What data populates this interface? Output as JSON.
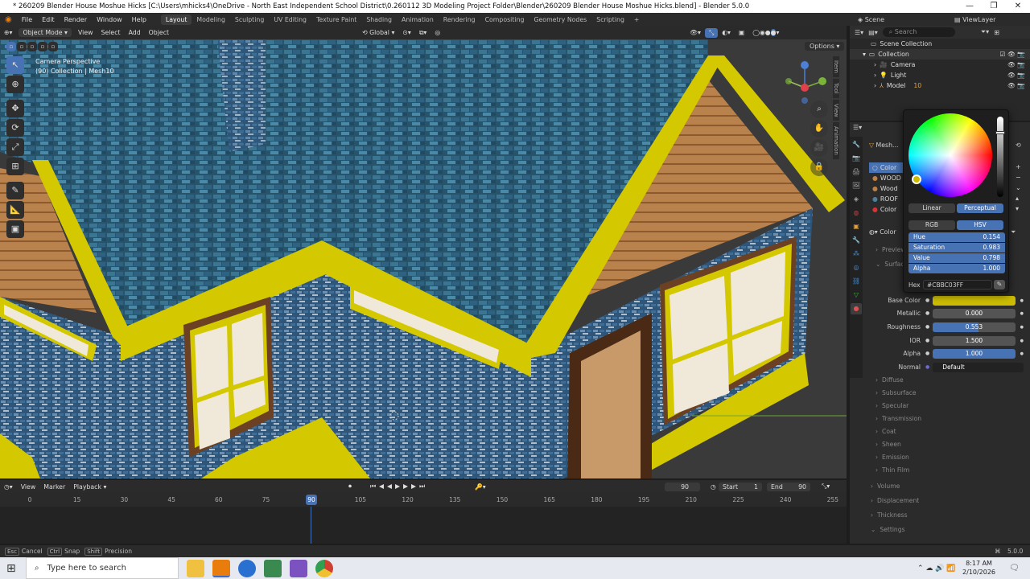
{
  "window": {
    "title": "* 260209 Blender House Moshue Hicks [C:\\Users\\mhicks4\\OneDrive - North East Independent School District\\0.260112 3D Modeling Project Folder\\Blender\\260209 Blender House Moshue Hicks.blend] - Blender 5.0.0",
    "min": "—",
    "max": "❐",
    "close": "✕"
  },
  "menu": {
    "items": [
      "File",
      "Edit",
      "Render",
      "Window",
      "Help"
    ],
    "workspaces": [
      "Layout",
      "Modeling",
      "Sculpting",
      "UV Editing",
      "Texture Paint",
      "Shading",
      "Animation",
      "Rendering",
      "Compositing",
      "Geometry Nodes",
      "Scripting"
    ],
    "add_tab": "+",
    "scene_label": "Scene",
    "viewlayer_label": "ViewLayer"
  },
  "viewport_header": {
    "mode": "Object Mode",
    "menus": [
      "View",
      "Select",
      "Add",
      "Object"
    ],
    "transform_orientation": "Global",
    "options": "Options"
  },
  "viewport": {
    "camera_label": "Camera Perspective",
    "collection_label": "(90) Collection | Mesh10",
    "side_tabs": [
      "Item",
      "Tool",
      "View",
      "Animation"
    ]
  },
  "outliner": {
    "search_placeholder": "Search",
    "root": "Scene Collection",
    "collection": "Collection",
    "items": [
      "Camera",
      "Light",
      "Model"
    ],
    "model_badge": "10"
  },
  "properties": {
    "object_name": "Mesh...",
    "materials": [
      "Color",
      "WOOD",
      "Wood",
      "ROOF",
      "Color"
    ],
    "material_header": "Color",
    "sections": [
      "Preview",
      "Surface"
    ],
    "fields": [
      {
        "label": "Base Color",
        "value": ""
      },
      {
        "label": "Metallic",
        "value": "0.000"
      },
      {
        "label": "Roughness",
        "value": "0.553"
      },
      {
        "label": "IOR",
        "value": "1.500"
      },
      {
        "label": "Alpha",
        "value": "1.000"
      },
      {
        "label": "Normal",
        "value": "Default"
      }
    ],
    "roughness_fill": 0.553,
    "subsections": [
      "Diffuse",
      "Subsurface",
      "Specular",
      "Transmission",
      "Coat",
      "Sheen",
      "Emission",
      "Thin Film"
    ],
    "panels": [
      "Volume",
      "Displacement",
      "Thickness",
      "Settings"
    ],
    "base_color": "#CBBC03"
  },
  "color_picker": {
    "modes_a": [
      "Linear",
      "Perceptual"
    ],
    "modes_b": [
      "RGB",
      "HSV"
    ],
    "rows": [
      {
        "label": "Hue",
        "value": "0.154"
      },
      {
        "label": "Saturation",
        "value": "0.983"
      },
      {
        "label": "Value",
        "value": "0.798"
      },
      {
        "label": "Alpha",
        "value": "1.000"
      }
    ],
    "hex_label": "Hex",
    "hex_value": "#CBBC03FF"
  },
  "timeline": {
    "menus": [
      "View",
      "Marker",
      "Playback"
    ],
    "current_frame": "90",
    "start_label": "Start",
    "start": "1",
    "end_label": "End",
    "end": "90",
    "ruler": [
      "0",
      "15",
      "30",
      "45",
      "60",
      "75",
      "90",
      "105",
      "120",
      "135",
      "150",
      "165",
      "180",
      "195",
      "210",
      "225",
      "240",
      "255"
    ],
    "playhead": "90"
  },
  "statusbar": {
    "items": [
      {
        "key": "Esc",
        "label": "Cancel"
      },
      {
        "key": "Ctrl",
        "label": "Snap"
      },
      {
        "key": "Shift",
        "label": "Precision"
      }
    ],
    "version": "5.0.0"
  },
  "taskbar": {
    "search_placeholder": "Type here to search",
    "time": "8:17 AM",
    "date": "2/10/2026"
  },
  "colors": {
    "accent": "#4772b3",
    "trim_yellow": "#d4c800",
    "roof_blue": "#2e5f7a",
    "brick_blue": "#3a6a90"
  }
}
